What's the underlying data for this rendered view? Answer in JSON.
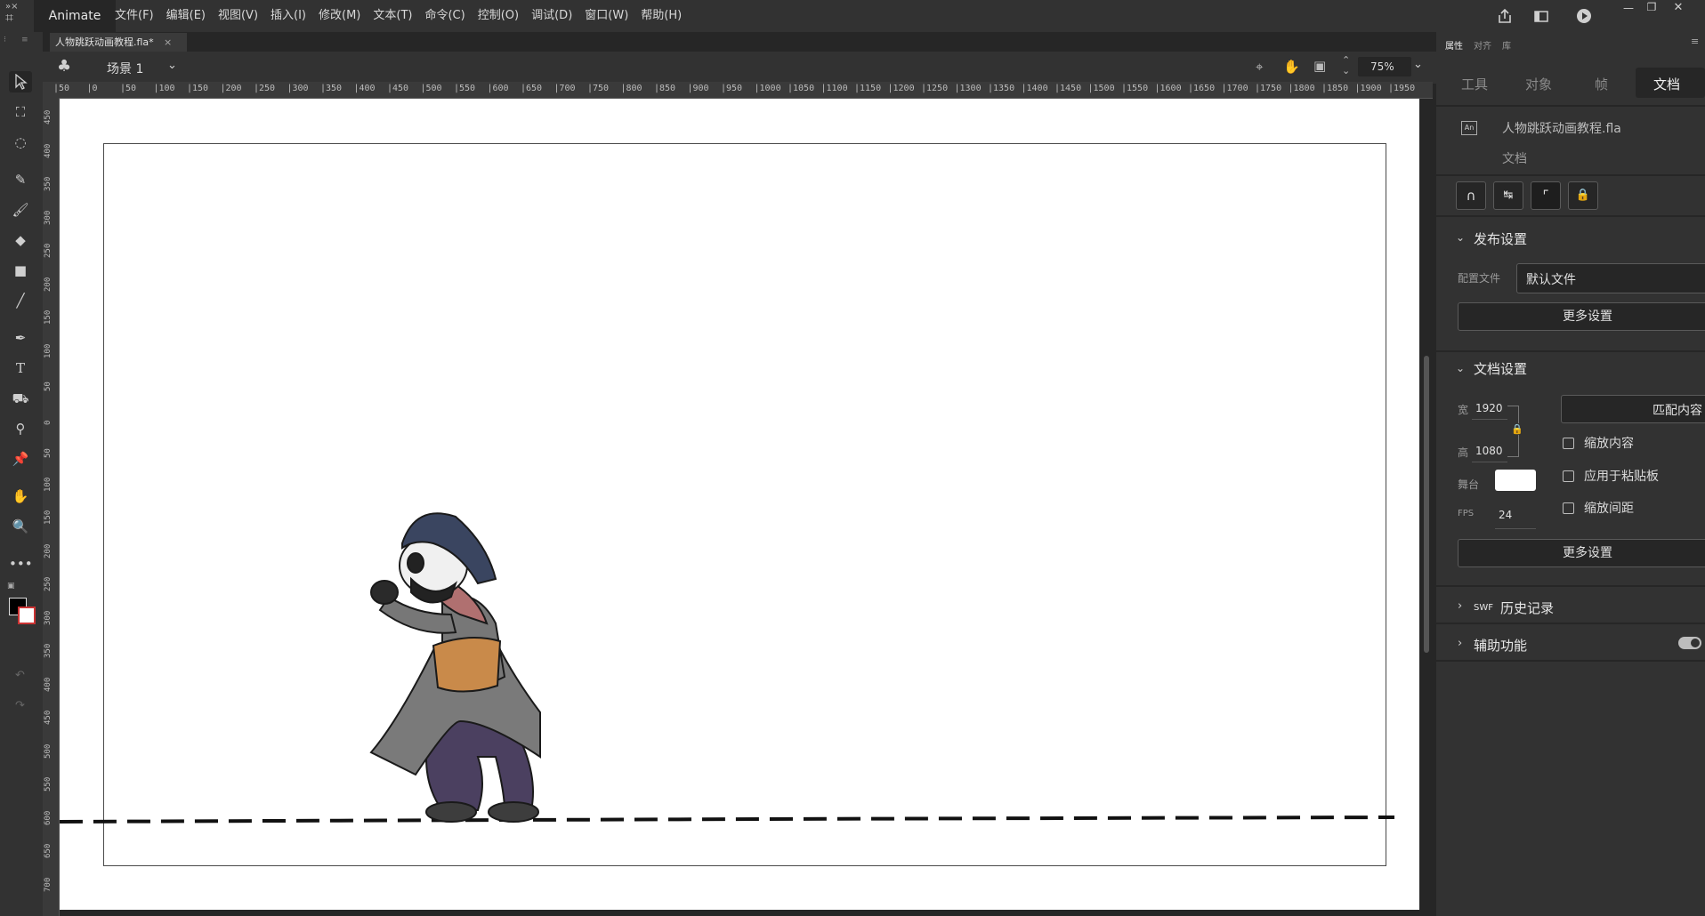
{
  "app": {
    "name": "Animate"
  },
  "menu": [
    "文件(F)",
    "编辑(E)",
    "视图(V)",
    "插入(I)",
    "修改(M)",
    "文本(T)",
    "命令(C)",
    "控制(O)",
    "调试(D)",
    "窗口(W)",
    "帮助(H)"
  ],
  "document": {
    "tab_title": "人物跳跃动画教程.fla*"
  },
  "editbar": {
    "scene": "场景 1",
    "zoom": "75%"
  },
  "ruler": {
    "h": [
      "50",
      "0",
      "50",
      "100",
      "150",
      "200",
      "250",
      "300",
      "350",
      "400",
      "450",
      "500",
      "550",
      "600",
      "650",
      "700",
      "750",
      "800",
      "850",
      "900",
      "950",
      "1000",
      "1050",
      "1100",
      "1150",
      "1200",
      "1250",
      "1300",
      "1350",
      "1400",
      "1450",
      "1500",
      "1550",
      "1600",
      "1650",
      "1700",
      "1750",
      "1800",
      "1850",
      "1900",
      "1950"
    ],
    "v": [
      "450",
      "400",
      "350",
      "300",
      "250",
      "200",
      "150",
      "100",
      "50",
      "0",
      "50",
      "100",
      "150",
      "200",
      "250",
      "300",
      "350",
      "400",
      "450",
      "500",
      "550",
      "600",
      "650",
      "700"
    ]
  },
  "panel": {
    "top_tabs": [
      "属性",
      "对齐",
      "库"
    ],
    "tabs": [
      "工具",
      "对象",
      "帧",
      "文档"
    ],
    "doc_name": "人物跳跃动画教程.fla",
    "doc_type": "文档",
    "publish": {
      "title": "发布设置",
      "profile_label": "配置文件",
      "profile_value": "默认文件",
      "more": "更多设置"
    },
    "docsettings": {
      "title": "文档设置",
      "width_label": "宽",
      "width": "1920",
      "height_label": "高",
      "height": "1080",
      "match_btn": "匹配内容",
      "stage_label": "舞台",
      "fps_label": "FPS",
      "fps": "24",
      "scale_content": "缩放内容",
      "apply_paste": "应用于粘贴板",
      "scale_spacing": "缩放间距",
      "more": "更多设置"
    },
    "swf": {
      "prefix": "SWF",
      "title": "历史记录"
    },
    "accessibility": {
      "title": "辅助功能"
    }
  },
  "colors": {
    "stage_bg": "#ffffff",
    "accent": "#e6e6e6"
  }
}
